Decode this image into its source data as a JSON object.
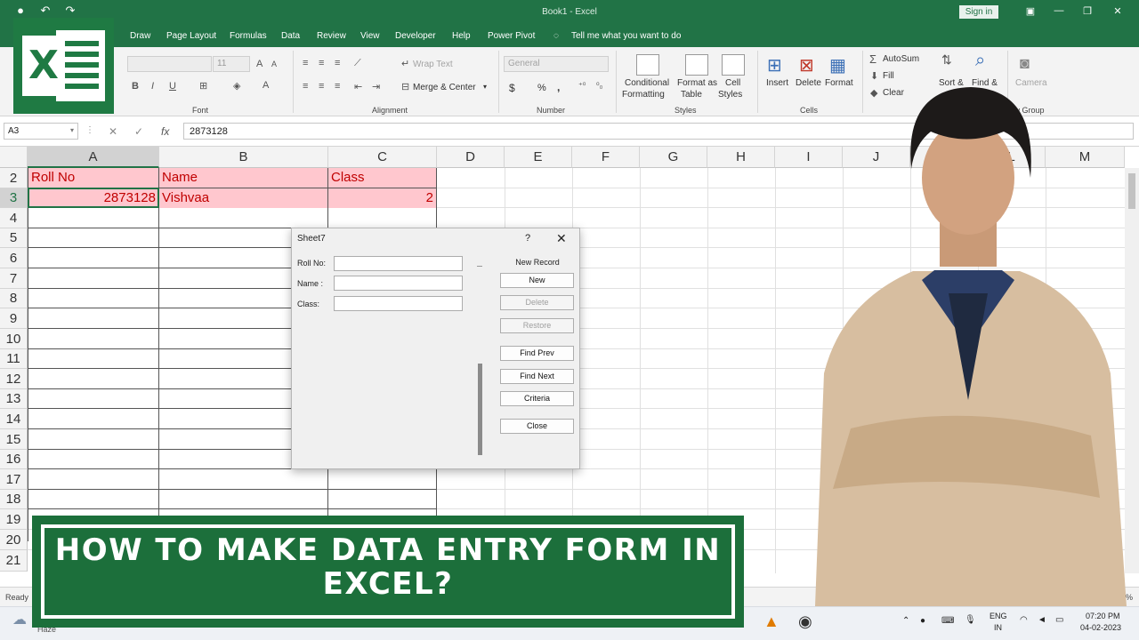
{
  "window": {
    "title": "Book1 - Excel",
    "signin_label": "Sign in"
  },
  "qat": {
    "save": "↶",
    "undo": "↶",
    "redo": "↷"
  },
  "ribbon_tabs": [
    "Draw",
    "Page Layout",
    "Formulas",
    "Data",
    "Review",
    "View",
    "Developer",
    "Help",
    "Power Pivot",
    "Tell me what you want to do"
  ],
  "ribbon": {
    "font": {
      "font_size": "11",
      "group_label": "Font"
    },
    "alignment": {
      "wrap_text": "Wrap Text",
      "merge_center": "Merge & Center",
      "group_label": "Alignment"
    },
    "number": {
      "format": "General",
      "currency": "$",
      "percent": "%",
      "comma": ",",
      "group_label": "Number"
    },
    "styles": {
      "conditional_formatting": [
        "Conditional",
        "Formatting"
      ],
      "format_as_table": [
        "Format as",
        "Table"
      ],
      "cell_styles": [
        "Cell",
        "Styles"
      ],
      "group_label": "Styles"
    },
    "cells": {
      "insert": "Insert",
      "delete": "Delete",
      "format": "Format",
      "group_label": "Cells"
    },
    "editing": {
      "autosum": "AutoSum",
      "fill": "Fill",
      "clear": "Clear",
      "sort": "Sort &",
      "find": "Find &"
    },
    "new_group": {
      "camera": "Camera",
      "group_label": "New Group"
    }
  },
  "formula_bar": {
    "name_box": "A3",
    "cancel": "✕",
    "enter": "✓",
    "fx": "fx",
    "value": "2873128"
  },
  "sheet": {
    "columns": [
      "A",
      "B",
      "C",
      "D",
      "E",
      "F",
      "G",
      "H",
      "I",
      "J",
      "K",
      "L",
      "M"
    ],
    "rows": [
      "2",
      "3",
      "4",
      "5",
      "6",
      "7",
      "8",
      "9",
      "10",
      "11",
      "12",
      "13",
      "14",
      "15",
      "16",
      "17",
      "18",
      "19",
      "20",
      "21"
    ],
    "headers": [
      "Roll No",
      "Name",
      "Class"
    ],
    "record": [
      "2873128",
      "Vishvaa",
      "2"
    ]
  },
  "dialog": {
    "title": "Sheet7",
    "help": "?",
    "close": "✕",
    "fields": [
      {
        "label": "Roll No:",
        "value": ""
      },
      {
        "label": "Name :",
        "value": ""
      },
      {
        "label": "Class:",
        "value": ""
      }
    ],
    "record_info": "New Record",
    "buttons": {
      "new": "New",
      "delete": "Delete",
      "restore": "Restore",
      "find_prev": "Find Prev",
      "find_next": "Find Next",
      "criteria": "Criteria",
      "close": "Close"
    }
  },
  "status": {
    "ready": "Ready",
    "zoom": "142%"
  },
  "taskbar": {
    "weather": "Haze",
    "lang": [
      "ENG",
      "IN"
    ],
    "time": "07:20 PM",
    "date": "04-02-2023"
  },
  "banner": {
    "text": "HOW TO MAKE DATA ENTRY FORM IN EXCEL?"
  },
  "colors": {
    "excel_green": "#217346",
    "header_fill": "#ffc7ce",
    "header_text": "#c00000",
    "banner_green": "#1c6f3b"
  }
}
